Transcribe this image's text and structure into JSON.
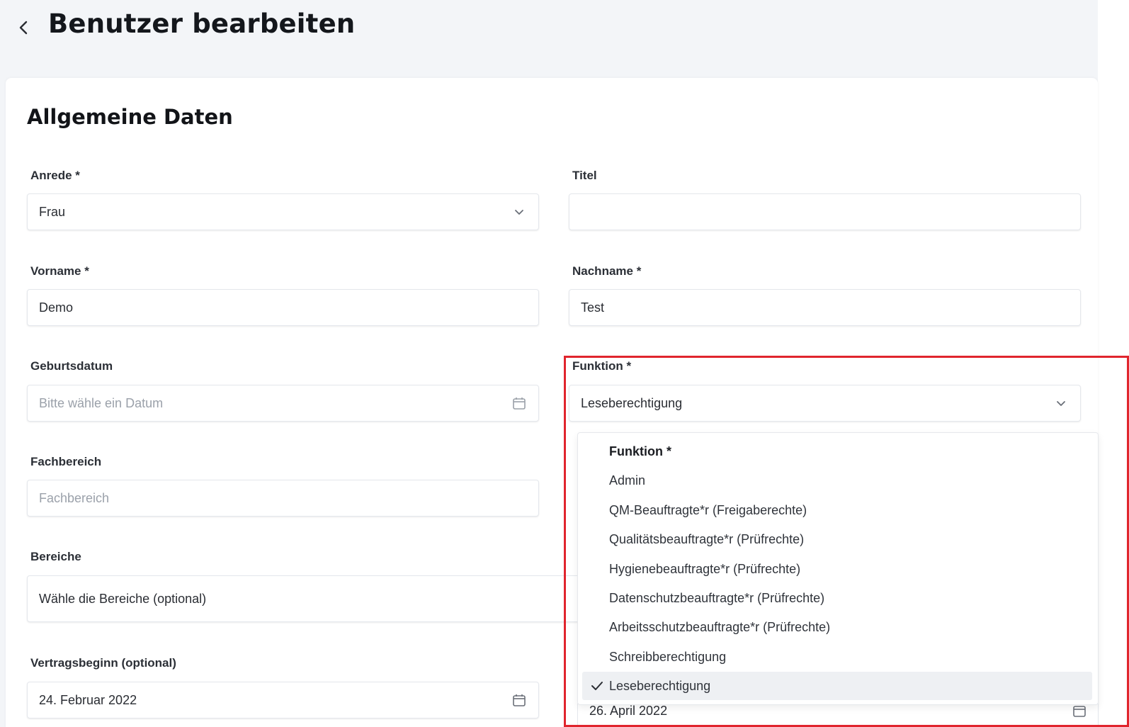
{
  "header": {
    "title": "Benutzer bearbeiten"
  },
  "section": {
    "title": "Allgemeine Daten"
  },
  "fields": {
    "anrede": {
      "label": "Anrede *",
      "value": "Frau"
    },
    "titel": {
      "label": "Titel",
      "value": ""
    },
    "vorname": {
      "label": "Vorname *",
      "value": "Demo"
    },
    "nachname": {
      "label": "Nachname *",
      "value": "Test"
    },
    "geburtsdatum": {
      "label": "Geburtsdatum",
      "placeholder": "Bitte wähle ein Datum"
    },
    "funktion": {
      "label": "Funktion *",
      "value": "Leseberechtigung"
    },
    "fachbereich": {
      "label": "Fachbereich",
      "placeholder": "Fachbereich"
    },
    "bereiche": {
      "label": "Bereiche",
      "placeholder": "Wähle die Bereiche (optional)"
    },
    "vertragsbeginn": {
      "label": "Vertragsbeginn (optional)",
      "value": "24. Februar 2022"
    },
    "vertragsende": {
      "value": "26. April 2022"
    }
  },
  "funktion_dropdown": {
    "header": "Funktion *",
    "options": [
      "Admin",
      "QM-Beauftragte*r (Freigaberechte)",
      "Qualitätsbeauftragte*r (Prüfrechte)",
      "Hygienebeauftragte*r (Prüfrechte)",
      "Datenschutzbeauftragte*r (Prüfrechte)",
      "Arbeitsschutzbeauftragte*r (Prüfrechte)",
      "Schreibberechtigung",
      "Leseberechtigung"
    ],
    "selected": "Leseberechtigung"
  },
  "colors": {
    "highlight": "#e0252d",
    "page_background": "#f3f5f8",
    "card_background": "#ffffff"
  },
  "icons": [
    "chevron-left-icon",
    "chevron-down-icon",
    "calendar-icon",
    "checkmark-icon"
  ]
}
